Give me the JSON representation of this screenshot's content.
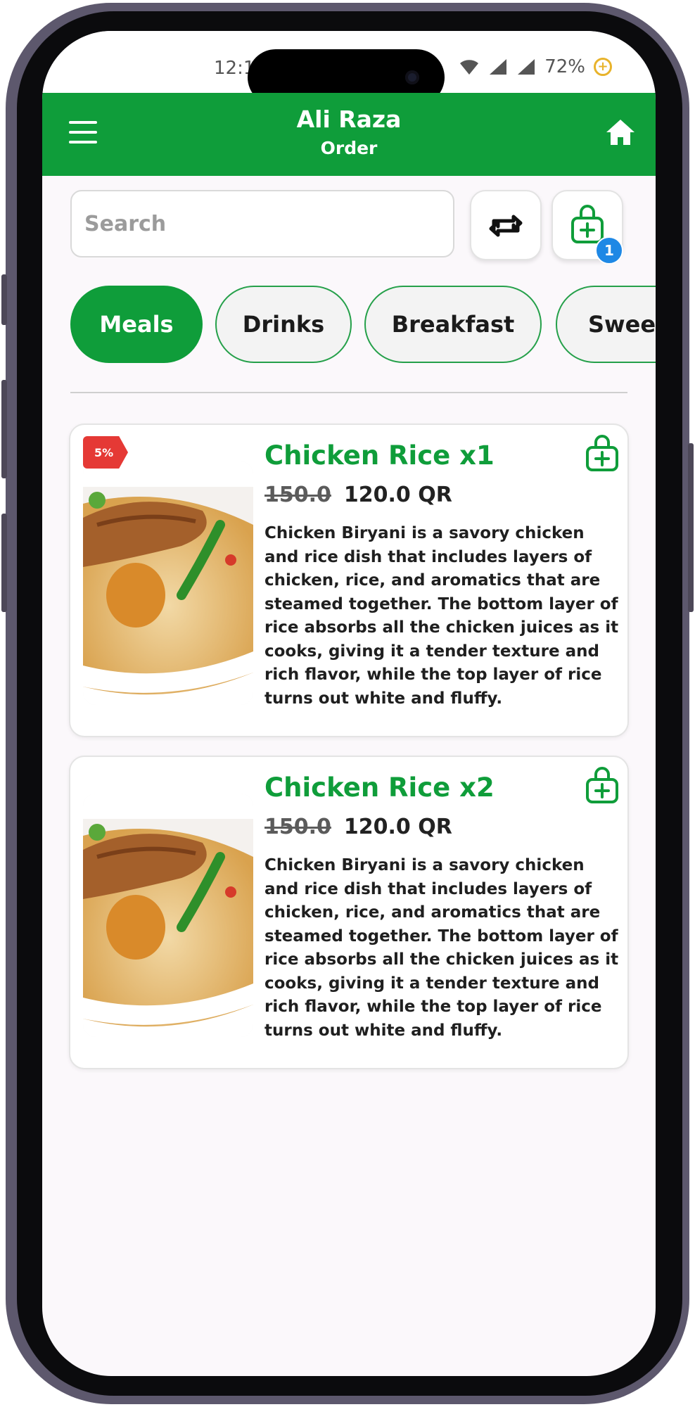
{
  "status_bar": {
    "time": "12:1",
    "battery": "72%"
  },
  "header": {
    "title": "Ali Raza",
    "subtitle": "Order"
  },
  "search": {
    "placeholder": "Search",
    "value": ""
  },
  "cart": {
    "count": "1"
  },
  "categories": [
    {
      "label": "Meals",
      "active": true
    },
    {
      "label": "Drinks",
      "active": false
    },
    {
      "label": "Breakfast",
      "active": false
    },
    {
      "label": "Sweets",
      "active": false
    }
  ],
  "products": [
    {
      "name": "Chicken Rice x1",
      "old_price": "150.0",
      "price": "120.0 QR",
      "discount": "5%",
      "description": "Chicken Biryani is a savory chicken and rice dish that includes layers of chicken, rice, and aromatics that are steamed together. The bottom layer of rice absorbs all the chicken juices as it cooks, giving it a tender texture and rich flavor, while the top layer of rice turns out white and fluffy."
    },
    {
      "name": "Chicken Rice x2",
      "old_price": "150.0",
      "price": "120.0 QR",
      "description": "Chicken Biryani is a savory chicken and rice dish that includes layers of chicken, rice, and aromatics that are steamed together. The bottom layer of rice absorbs all the chicken juices as it cooks, giving it a tender texture and rich flavor, while the top layer of rice turns out white and fluffy."
    }
  ],
  "colors": {
    "brand": "#0f9d3a",
    "badge": "#1e88e5",
    "discount": "#e53935"
  }
}
